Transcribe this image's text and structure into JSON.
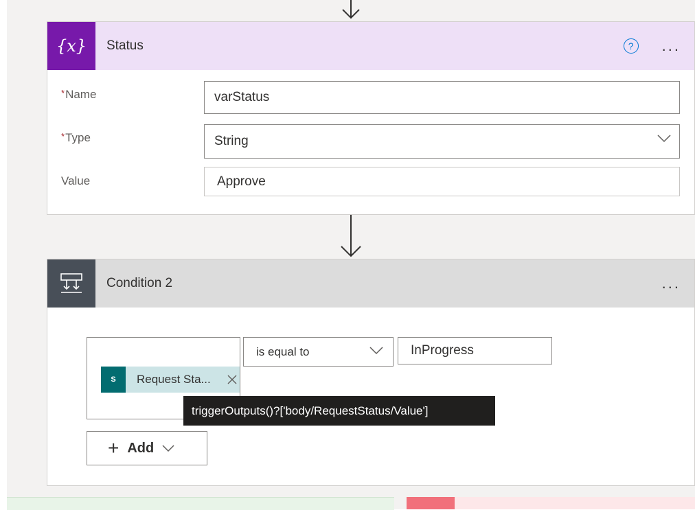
{
  "status_action": {
    "title": "Status",
    "icon_text": "{x}",
    "fields": {
      "name_label": "Name",
      "name_value": "varStatus",
      "type_label": "Type",
      "type_value": "String",
      "value_label": "Value",
      "value_value": "Approve"
    },
    "required_marker": "*",
    "accent_color": "#7719aa"
  },
  "condition_action": {
    "title": "Condition 2",
    "left_token": {
      "icon_text": "S",
      "label": "Request Sta...",
      "tooltip": "triggerOutputs()?['body/RequestStatus/Value']"
    },
    "operator": "is equal to",
    "right_value": "InProgress",
    "add_label": "Add"
  },
  "menu_glyph": "...",
  "help_glyph": "?"
}
